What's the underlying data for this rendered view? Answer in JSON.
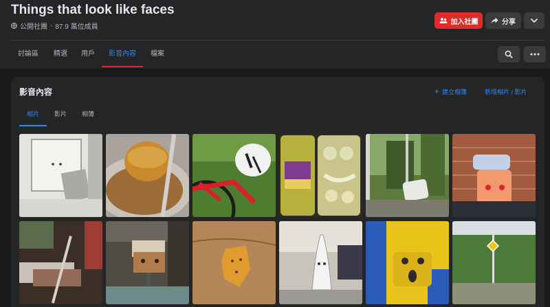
{
  "group": {
    "name": "Things that look like faces",
    "privacy": "公開社團",
    "members": "87.9 萬位成員",
    "separator": "·"
  },
  "header_buttons": {
    "join": "加入社團",
    "share": "分享"
  },
  "nav": {
    "tabs": [
      "討論區",
      "精選",
      "用戶",
      "影音內容",
      "檔案"
    ],
    "active_tab": "影音內容"
  },
  "media": {
    "title": "影音內容",
    "create_album": "建立相簿",
    "add_media": "新增相片 / 影片",
    "subtabs": [
      "相片",
      "影片",
      "相簿"
    ],
    "active_subtab": "相片"
  },
  "photos": [
    {
      "icon": "wall-mounted-box-photo"
    },
    {
      "icon": "fried-patty-plate-photo"
    },
    {
      "icon": "bicycle-helmet-photo"
    },
    {
      "icon": "pickle-jars-photo"
    },
    {
      "icon": "window-forest-photo"
    },
    {
      "icon": "orange-sander-photo"
    },
    {
      "icon": "dark-room-stool-photo"
    },
    {
      "icon": "cardboard-box-chair-photo"
    },
    {
      "icon": "cracker-on-table-photo"
    },
    {
      "icon": "clothes-iron-photo"
    },
    {
      "icon": "yellow-machine-face-photo"
    },
    {
      "icon": "street-sign-trees-photo"
    }
  ],
  "colors": {
    "accent_blue": "#2d88ff",
    "join_red": "#e12a2a",
    "background": "#18191a",
    "surface": "#242526"
  }
}
